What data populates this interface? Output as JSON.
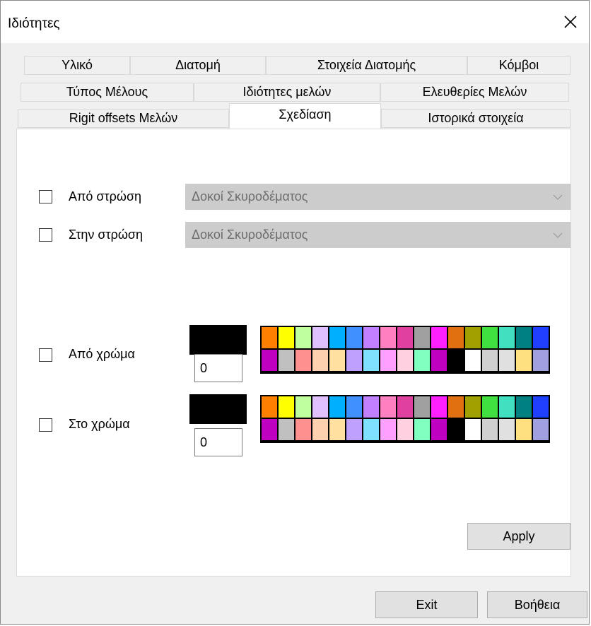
{
  "window": {
    "title": "Ιδιότητες"
  },
  "tabs": {
    "row1": [
      "Υλικό",
      "Διατομή",
      "Στοιχεία Διατομής",
      "Κόμβοι"
    ],
    "row2": [
      "Τύπος Μέλους",
      "Ιδιότητες μελών",
      "Ελευθερίες Μελών"
    ],
    "row3": [
      "Rigit offsets Μελών",
      "Σχεδίαση",
      "Ιστορικά στοιχεία"
    ],
    "active": "Σχεδίαση"
  },
  "form": {
    "from_layer_label": "Από στρώση",
    "from_layer_value": "Δοκοί Σκυροδέματος",
    "to_layer_label": "Στην στρώση",
    "to_layer_value": "Δοκοί Σκυροδέματος",
    "from_color_label": "Από χρώμα",
    "from_color_value": "0",
    "to_color_label": "Στο χρώμα",
    "to_color_value": "0",
    "selected_color": "#000000"
  },
  "palette": {
    "row1": [
      "#ff8000",
      "#ffff00",
      "#c0ffa0",
      "#e0c0ff",
      "#00b0ff",
      "#4090ff",
      "#c080ff",
      "#ff80c0",
      "#e040a0",
      "#a0a0a0",
      "#ff20ff",
      "#e07010",
      "#a0a000",
      "#40e040",
      "#40e0c0",
      "#008080",
      "#2040ff",
      "#c000c0",
      "#c0c0c0"
    ],
    "row2": [
      "#ff9090",
      "#ffd0b0",
      "#ffe0a0",
      "#c0a0ff",
      "#80e0ff",
      "#ffa0ff",
      "#ffd0e0",
      "#80ffc0",
      "#c000c0",
      "#000000",
      "#ffffff",
      "#d0d0d0",
      "#e0e0e0",
      "#ffe080",
      "#a0a0e0",
      "#008040",
      "#00a040",
      "#e08040",
      "#c08060"
    ]
  },
  "buttons": {
    "apply": "Apply",
    "exit": "Exit",
    "help": "Βοήθεια"
  }
}
